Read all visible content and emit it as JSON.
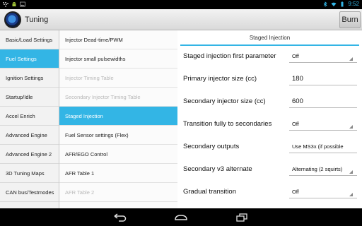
{
  "status": {
    "time": "9:52",
    "icons_left": [
      "blackberry-logo-icon",
      "android-icon",
      "image-icon"
    ],
    "icons_right": [
      "bluetooth-icon",
      "wifi-icon",
      "battery-icon"
    ]
  },
  "actionbar": {
    "title": "Tuning",
    "burn_label": "Burn"
  },
  "categories": [
    {
      "label": "Basic/Load Settings",
      "active": false
    },
    {
      "label": "Fuel Settings",
      "active": true
    },
    {
      "label": "Ignition Settings",
      "active": false
    },
    {
      "label": "Startup/Idle",
      "active": false
    },
    {
      "label": "Accel Enrich",
      "active": false
    },
    {
      "label": "Advanced Engine",
      "active": false
    },
    {
      "label": "Advanced Engine 2",
      "active": false
    },
    {
      "label": "3D Tuning Maps",
      "active": false
    },
    {
      "label": "CAN bus/Testmodes",
      "active": false
    }
  ],
  "pages": [
    {
      "label": "Injector Dead-time/PWM",
      "state": "normal"
    },
    {
      "label": "Injector small pulsewidths",
      "state": "normal"
    },
    {
      "label": "Injector Timing Table",
      "state": "disabled"
    },
    {
      "label": "Secondary Injector Timing Table",
      "state": "disabled"
    },
    {
      "label": "Staged Injection",
      "state": "active"
    },
    {
      "label": "Fuel Sensor settings (Flex)",
      "state": "normal"
    },
    {
      "label": "AFR/EGO Control",
      "state": "normal"
    },
    {
      "label": "AFR Table 1",
      "state": "normal"
    },
    {
      "label": "AFR Table 2",
      "state": "disabled"
    }
  ],
  "detail": {
    "header": "Staged Injection",
    "fields": [
      {
        "label": "Staged injection first parameter",
        "value": "Off",
        "kind": "select"
      },
      {
        "label": "Primary injector size (cc)",
        "value": "180",
        "kind": "input"
      },
      {
        "label": "Secondary injector size (cc)",
        "value": "600",
        "kind": "input"
      },
      {
        "label": "Transition fully to secondaries",
        "value": "Off",
        "kind": "select"
      },
      {
        "label": "Secondary outputs",
        "value": "Use MS3x (if possible",
        "kind": "select"
      },
      {
        "label": "Secondary v3 alternate",
        "value": "Alternating (2 squirts)",
        "kind": "select"
      },
      {
        "label": "Gradual transition",
        "value": "Off",
        "kind": "select"
      }
    ]
  },
  "navbar": {
    "buttons": [
      "back-icon",
      "home-icon",
      "recent-apps-icon"
    ]
  },
  "colors": {
    "accent": "#33b5e5"
  }
}
